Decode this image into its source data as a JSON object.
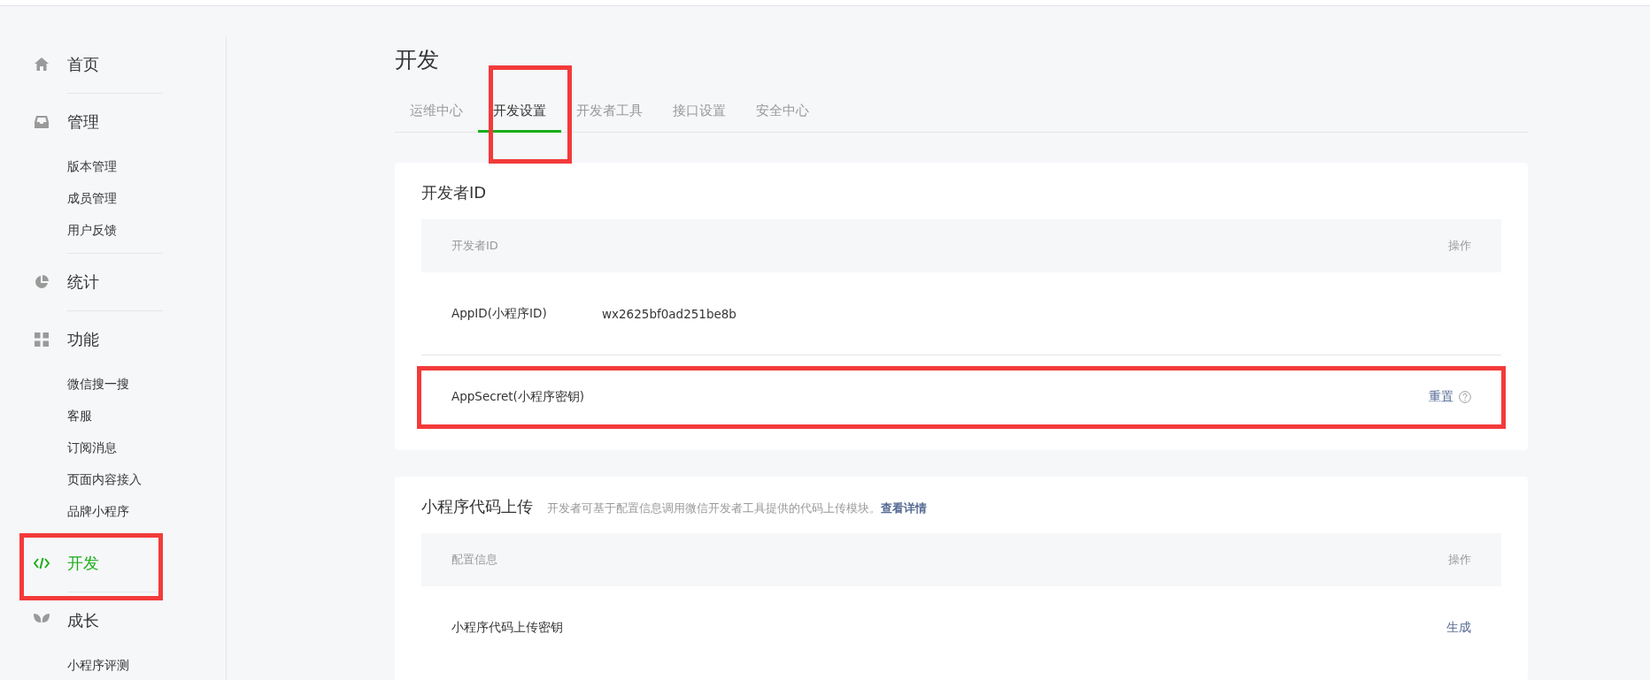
{
  "sidebar": {
    "items": [
      {
        "label": "首页",
        "selected": false
      },
      {
        "label": "管理",
        "selected": false,
        "children": [
          {
            "label": "版本管理"
          },
          {
            "label": "成员管理"
          },
          {
            "label": "用户反馈"
          }
        ]
      },
      {
        "label": "统计",
        "selected": false
      },
      {
        "label": "功能",
        "selected": false,
        "children": [
          {
            "label": "微信搜一搜"
          },
          {
            "label": "客服"
          },
          {
            "label": "订阅消息"
          },
          {
            "label": "页面内容接入"
          },
          {
            "label": "品牌小程序"
          }
        ]
      },
      {
        "label": "开发",
        "selected": true,
        "highlighted": true
      },
      {
        "label": "成长",
        "selected": false,
        "children": [
          {
            "label": "小程序评测"
          }
        ]
      }
    ]
  },
  "page_title": "开发",
  "tabs": [
    {
      "label": "运维中心",
      "selected": false
    },
    {
      "label": "开发设置",
      "selected": true,
      "highlighted": true
    },
    {
      "label": "开发者工具",
      "selected": false
    },
    {
      "label": "接口设置",
      "selected": false
    },
    {
      "label": "安全中心",
      "selected": false
    }
  ],
  "cards": [
    {
      "title": "开发者ID",
      "columns": [
        "开发者ID",
        "操作"
      ],
      "rows": [
        {
          "name": "AppID(小程序ID)",
          "value": "wx2625bf0ad251be8b"
        },
        {
          "name": "AppSecret(小程序密钥)",
          "action": "重置",
          "help": true,
          "highlighted": true
        }
      ]
    },
    {
      "title": "小程序代码上传",
      "description": "开发者可基于配置信息调用微信开发者工具提供的代码上传模块。",
      "link": "查看详情",
      "columns": [
        "配置信息",
        "操作"
      ],
      "rows": [
        {
          "name": "小程序代码上传密钥",
          "action": "生成"
        }
      ]
    }
  ]
}
